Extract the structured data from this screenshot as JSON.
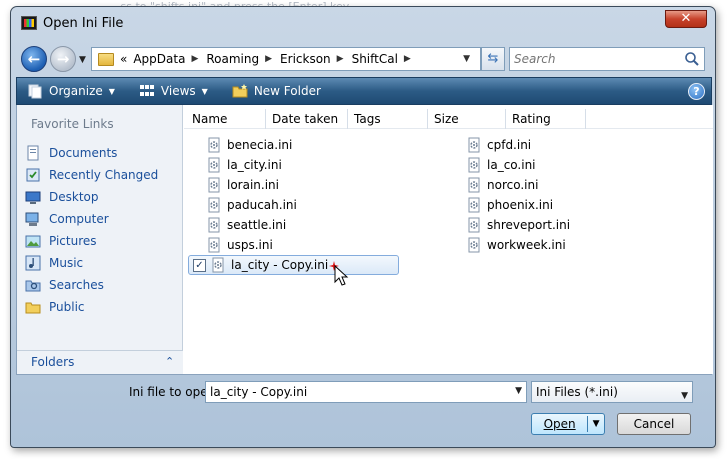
{
  "window": {
    "title": "Open Ini File",
    "close_label": "✕"
  },
  "nav": {
    "breadcrumb": [
      "«",
      "AppData",
      "Roaming",
      "Erickson",
      "ShiftCal"
    ],
    "search_placeholder": "Search"
  },
  "toolbar": {
    "organize_label": "Organize",
    "views_label": "Views",
    "new_folder_label": "New Folder",
    "help_label": "?"
  },
  "sidebar": {
    "header": "Favorite Links",
    "items": [
      {
        "label": "Documents",
        "icon": "documents-icon"
      },
      {
        "label": "Recently Changed",
        "icon": "recently-changed-icon"
      },
      {
        "label": "Desktop",
        "icon": "desktop-icon"
      },
      {
        "label": "Computer",
        "icon": "computer-icon"
      },
      {
        "label": "Pictures",
        "icon": "pictures-icon"
      },
      {
        "label": "Music",
        "icon": "music-icon"
      },
      {
        "label": "Searches",
        "icon": "searches-icon"
      },
      {
        "label": "Public",
        "icon": "public-folder-icon"
      }
    ],
    "folders_label": "Folders",
    "folders_chevron": "⌃"
  },
  "columns": [
    "Name",
    "Date taken",
    "Tags",
    "Size",
    "Rating"
  ],
  "files_left": [
    "benecia.ini",
    "la_city.ini",
    "lorain.ini",
    "paducah.ini",
    "seattle.ini",
    "usps.ini"
  ],
  "files_right": [
    "cpfd.ini",
    "la_co.ini",
    "norco.ini",
    "phoenix.ini",
    "shreveport.ini",
    "workweek.ini"
  ],
  "selected_file": {
    "label": "la_city - Copy.ini",
    "checked": true
  },
  "bottom": {
    "filename_label": "Ini file to open:",
    "filename_value": "la_city - Copy.ini",
    "filetype_value": "Ini Files (*.ini)",
    "open_label": "Open",
    "cancel_label": "Cancel"
  },
  "background_text": "...ss to \"shifts.ini\" and press the [Enter] key"
}
